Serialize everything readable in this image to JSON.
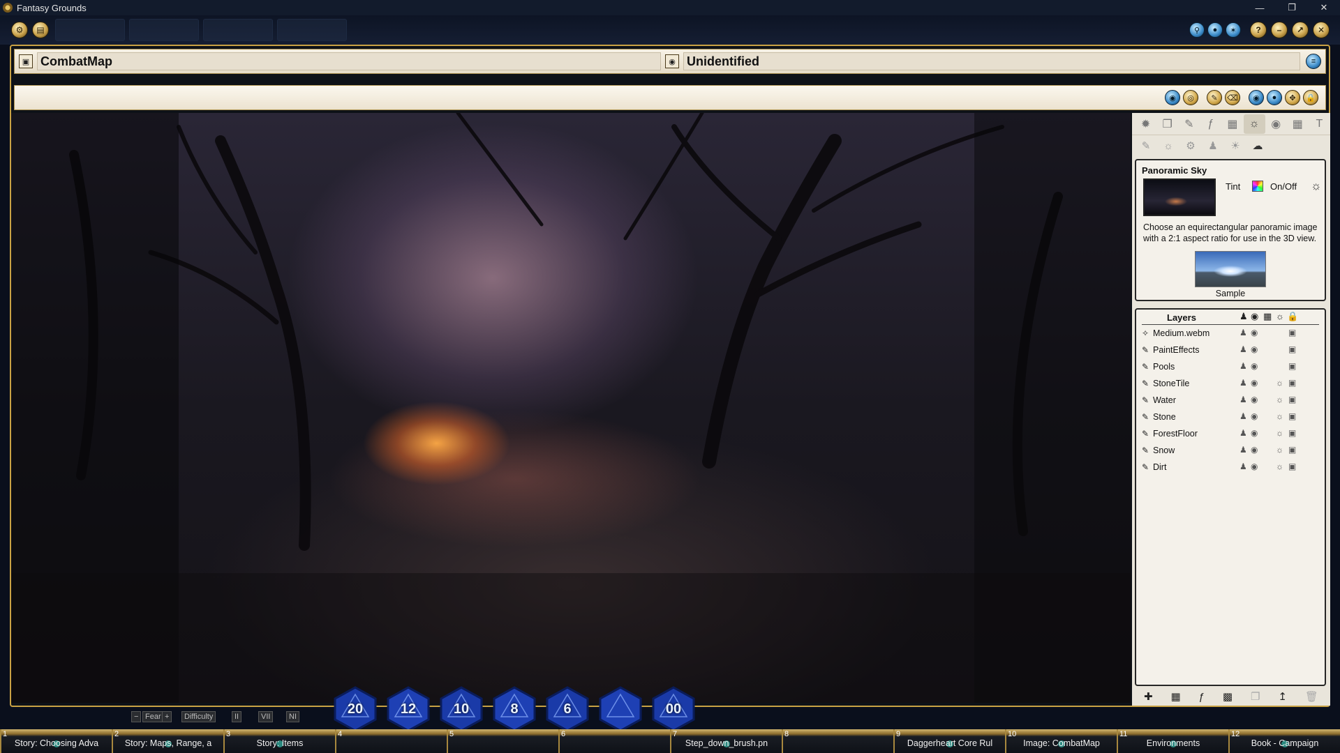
{
  "app": {
    "title": "Fantasy Grounds"
  },
  "window": {
    "name": "CombatMap",
    "unidentified": "Unidentified"
  },
  "panel": {
    "sky": {
      "header": "Panoramic Sky",
      "tint_label": "Tint",
      "onoff_label": "On/Off",
      "description": "Choose an equirectangular panoramic image with a 2:1 aspect ratio for use in the 3D view.",
      "sample_label": "Sample"
    },
    "layers": {
      "header": "Layers",
      "items": [
        {
          "name": "Medium.webm",
          "kind": "video-icon",
          "light": false
        },
        {
          "name": "PaintEffects",
          "kind": "brush-icon",
          "light": false
        },
        {
          "name": "Pools",
          "kind": "brush-icon",
          "light": false
        },
        {
          "name": "StoneTile",
          "kind": "brush-icon",
          "light": true
        },
        {
          "name": "Water",
          "kind": "brush-icon",
          "light": true
        },
        {
          "name": "Stone",
          "kind": "brush-icon",
          "light": true
        },
        {
          "name": "ForestFloor",
          "kind": "brush-icon",
          "light": true
        },
        {
          "name": "Snow",
          "kind": "brush-icon",
          "light": true
        },
        {
          "name": "Dirt",
          "kind": "brush-icon",
          "light": true
        }
      ]
    }
  },
  "dice": [
    {
      "label": "20",
      "color": "#1a3aa8"
    },
    {
      "label": "12",
      "color": "#1e40b4"
    },
    {
      "label": "10",
      "color": "#1a3aa8"
    },
    {
      "label": "8",
      "color": "#1e40b4"
    },
    {
      "label": "6",
      "color": "#1a3aa8"
    },
    {
      "label": "",
      "color": "#1e40b4"
    },
    {
      "label": "00",
      "color": "#1a3aa8"
    }
  ],
  "chips": {
    "fear": "Fear",
    "difficulty": "Difficulty",
    "modes": [
      "II",
      "VII",
      "NI"
    ]
  },
  "hotbar": [
    {
      "num": "1",
      "label": "Story: Choosing Adva"
    },
    {
      "num": "2",
      "label": "Story: Maps, Range, a"
    },
    {
      "num": "3",
      "label": "Story: Items"
    },
    {
      "num": "4",
      "label": ""
    },
    {
      "num": "5",
      "label": ""
    },
    {
      "num": "6",
      "label": ""
    },
    {
      "num": "7",
      "label": "Step_down_brush.pn"
    },
    {
      "num": "8",
      "label": ""
    },
    {
      "num": "9",
      "label": "Daggerheart Core Rul"
    },
    {
      "num": "10",
      "label": "Image: CombatMap"
    },
    {
      "num": "11",
      "label": "Environments"
    },
    {
      "num": "12",
      "label": "Book - Campaign"
    }
  ]
}
